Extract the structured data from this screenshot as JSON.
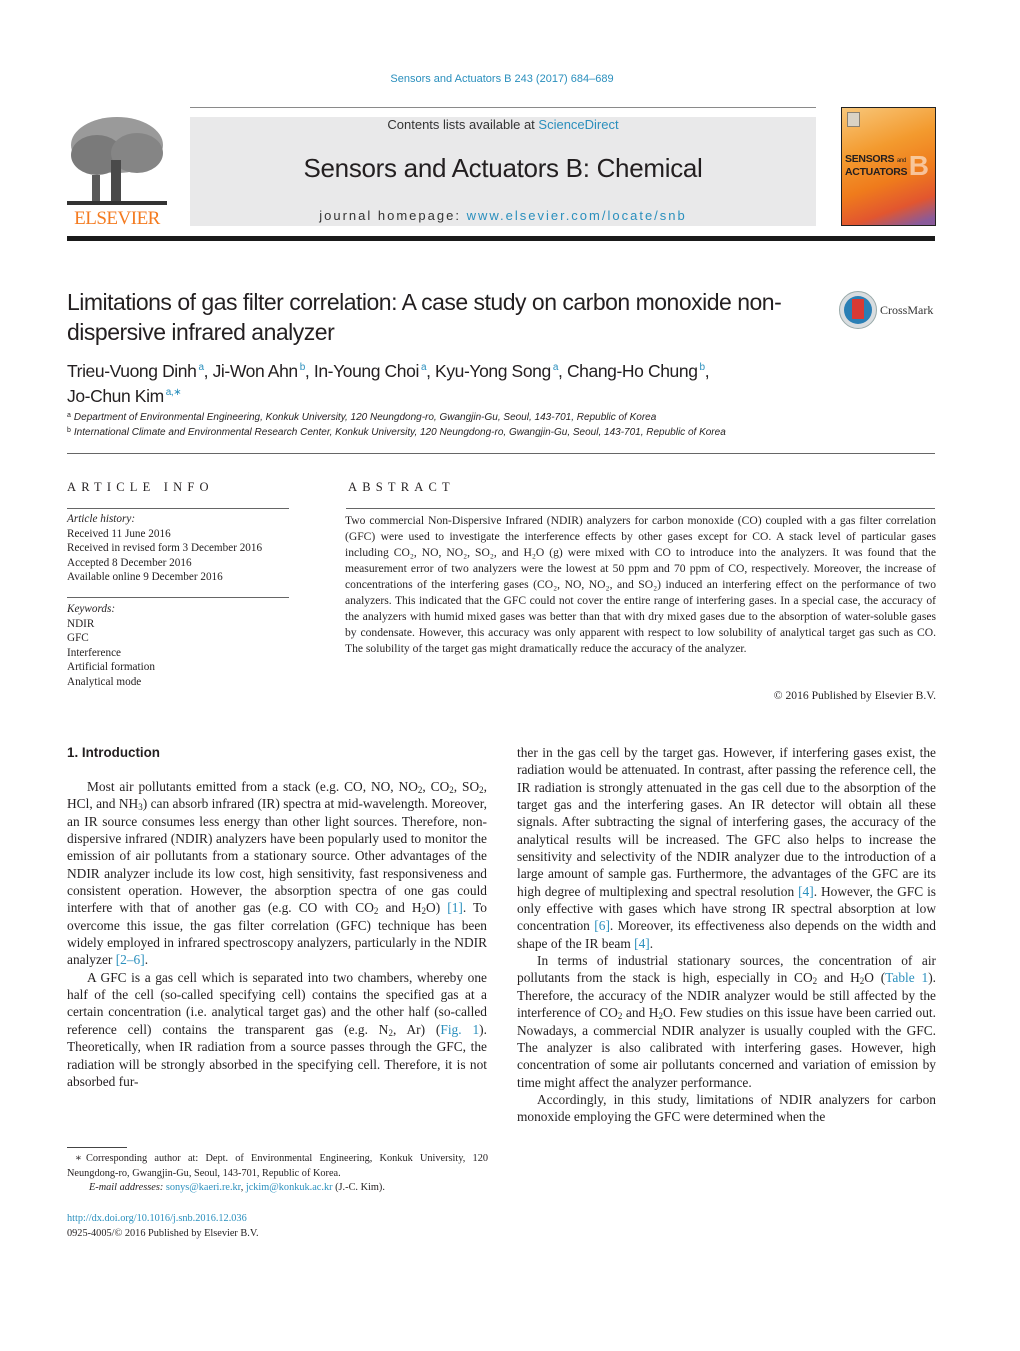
{
  "header": {
    "citation": "Sensors and Actuators B 243 (2017) 684–689",
    "publisher_logo_text": "ELSEVIER",
    "contents_prefix": "Contents lists available at ",
    "contents_link": "ScienceDirect",
    "journal_name": "Sensors and Actuators B: Chemical",
    "homepage_prefix": "journal homepage: ",
    "homepage_link": "www.elsevier.com/locate/snb",
    "cover_line1": "SENSORS",
    "cover_and": "and",
    "cover_line2": "ACTUATORS",
    "cover_letter": "B",
    "crossmark_label": "CrossMark"
  },
  "article": {
    "title": "Limitations of gas filter correlation: A case study on carbon monoxide non-dispersive infrared analyzer",
    "authors": [
      {
        "name": "Trieu-Vuong Dinh",
        "aff": "a"
      },
      {
        "name": "Ji-Won Ahn",
        "aff": "b"
      },
      {
        "name": "In-Young Choi",
        "aff": "a"
      },
      {
        "name": "Kyu-Yong Song",
        "aff": "a"
      },
      {
        "name": "Chang-Ho Chung",
        "aff": "b"
      },
      {
        "name": "Jo-Chun Kim",
        "aff": "a,∗"
      }
    ],
    "affiliations": [
      {
        "mark": "a",
        "text": "Department of Environmental Engineering, Konkuk University, 120 Neungdong-ro, Gwangjin-Gu, Seoul, 143-701, Republic of Korea"
      },
      {
        "mark": "b",
        "text": "International Climate and Environmental Research Center, Konkuk University, 120 Neungdong-ro, Gwangjin-Gu, Seoul, 143-701, Republic of Korea"
      }
    ]
  },
  "article_info": {
    "heading": "ARTICLE INFO",
    "history_label": "Article history:",
    "history": [
      "Received 11 June 2016",
      "Received in revised form 3 December 2016",
      "Accepted 8 December 2016",
      "Available online 9 December 2016"
    ],
    "keywords_label": "Keywords:",
    "keywords": [
      "NDIR",
      "GFC",
      "Interference",
      "Artificial formation",
      "Analytical mode"
    ]
  },
  "abstract": {
    "heading": "ABSTRACT",
    "text": "Two commercial Non-Dispersive Infrared (NDIR) analyzers for carbon monoxide (CO) coupled with a gas filter correlation (GFC) were used to investigate the interference effects by other gases except for CO. A stack level of particular gases including CO₂, NO, NO₂, SO₂, and H₂O (g) were mixed with CO to introduce into the analyzers. It was found that the measurement error of two analyzers were the lowest at 50 ppm and 70 ppm of CO, respectively. Moreover, the increase of concentrations of the interfering gases (CO₂, NO, NO₂, and SO₂) induced an interfering effect on the performance of two analyzers. This indicated that the GFC could not cover the entire range of interfering gases. In a special case, the accuracy of the analyzers with humid mixed gases was better than that with dry mixed gases due to the absorption of water-soluble gases by condensate. However, this accuracy was only apparent with respect to low solubility of analytical target gas such as CO. The solubility of the target gas might dramatically reduce the accuracy of the analyzer.",
    "copyright": "© 2016 Published by Elsevier B.V."
  },
  "body": {
    "section_heading": "1.  Introduction",
    "left_paragraphs": [
      "Most air pollutants emitted from a stack (e.g. CO, NO, NO₂, CO₂, SO₂, HCl, and NH₃) can absorb infrared (IR) spectra at mid-wavelength. Moreover, an IR source consumes less energy than other light sources. Therefore, non-dispersive infrared (NDIR) analyzers have been popularly used to monitor the emission of air pollutants from a stationary source. Other advantages of the NDIR analyzer include its low cost, high sensitivity, fast responsiveness and consistent operation. However, the absorption spectra of one gas could interfere with that of another gas (e.g. CO with CO₂ and H₂O) [1]. To overcome this issue, the gas filter correlation (GFC) technique has been widely employed in infrared spectroscopy analyzers, particularly in the NDIR analyzer [2–6].",
      "A GFC is a gas cell which is separated into two chambers, whereby one half of the cell (so-called specifying cell) contains the specified gas at a certain concentration (i.e. analytical target gas) and the other half (so-called reference cell) contains the transparent gas (e.g. N₂, Ar) (Fig. 1). Theoretically, when IR radiation from a source passes through the GFC, the radiation will be strongly absorbed in the specifying cell. Therefore, it is not absorbed fur-"
    ],
    "right_paragraphs": [
      "ther in the gas cell by the target gas. However, if interfering gases exist, the radiation would be attenuated. In contrast, after passing the reference cell, the IR radiation is strongly attenuated in the gas cell due to the absorption of the target gas and the interfering gases. An IR detector will obtain all these signals. After subtracting the signal of interfering gases, the accuracy of the analytical results will be increased. The GFC also helps to increase the sensitivity and selectivity of the NDIR analyzer due to the introduction of a large amount of sample gas. Furthermore, the advantages of the GFC are its high degree of multiplexing and spectral resolution [4]. However, the GFC is only effective with gases which have strong IR spectral absorption at low concentration [6]. Moreover, its effectiveness also depends on the width and shape of the IR beam [4].",
      "In terms of industrial stationary sources, the concentration of air pollutants from the stack is high, especially in CO₂ and H₂O (Table 1). Therefore, the accuracy of the NDIR analyzer would be still affected by the interference of CO₂ and H₂O. Few studies on this issue have been carried out. Nowadays, a commercial NDIR analyzer is usually coupled with the GFC. The analyzer is also calibrated with interfering gases. However, high concentration of some air pollutants concerned and variation of emission by time might affect the analyzer performance.",
      "Accordingly, in this study, limitations of NDIR analyzers for carbon monoxide employing the GFC were determined when the"
    ]
  },
  "footnote": {
    "star": "∗",
    "corresponding": "Corresponding author at: Dept. of Environmental Engineering, Konkuk University, 120 Neungdong-ro, Gwangjin-Gu, Seoul, 143-701, Republic of Korea.",
    "email_label": "E-mail addresses:",
    "email1": "sonys@kaeri.re.kr",
    "email2": "jckim@konkuk.ac.kr",
    "email_suffix": "(J.-C. Kim).",
    "doi": "http://dx.doi.org/10.1016/j.snb.2016.12.036",
    "issn": "0925-4005/© 2016 Published by Elsevier B.V."
  },
  "colors": {
    "link": "#2a8fbd",
    "elsevier_orange": "#f47b20",
    "masthead_gray": "#e9e9ea"
  }
}
